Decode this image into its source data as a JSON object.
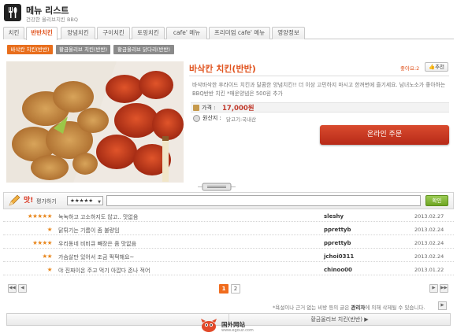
{
  "header": {
    "title": "메뉴 리스트",
    "subtitle": "건강한 올리브치킨 BBQ"
  },
  "tabs": [
    {
      "label": "치킨",
      "active": false
    },
    {
      "label": "반반치킨",
      "active": true
    },
    {
      "label": "양념치킨",
      "active": false
    },
    {
      "label": "구이치킨",
      "active": false
    },
    {
      "label": "토핑치킨",
      "active": false
    },
    {
      "label": "cafe' 메뉴",
      "active": false
    },
    {
      "label": "프리미엄 cafe' 메뉴",
      "active": false
    },
    {
      "label": "영양정보",
      "active": false
    }
  ],
  "subtabs": [
    {
      "label": "바삭칸 치킨(반반)",
      "active": true
    },
    {
      "label": "황금올리브 치킨(반반)",
      "active": false
    },
    {
      "label": "황금올리브 닭다리(반반)",
      "active": false
    }
  ],
  "product": {
    "name": "바삭칸 치킨(반반)",
    "like_label": "좋아요:2",
    "recommend_label": "추천",
    "description": "바삭바삭한 후라이드 치킨과 달콤한 양념치킨!! 더 이상 고민하지 마시고 한꺼번에 즐기세요. 남녀노소가 좋아하는 BBQ반반 치킨 *매운양념은 500원 추가",
    "price_label": "가격 :",
    "price_value": "17,000원",
    "origin_label": "원산지 :",
    "origin_value": "닭고기:국내산",
    "order_label": "온라인 주문"
  },
  "review_form": {
    "mat_label": "맛!",
    "label": "평가하기",
    "rating_value": "★★★★★",
    "confirm_label": "확인"
  },
  "reviews": [
    {
      "stars": "★★★★★",
      "text": "녹녹하고 고소하지도 않고.. 맛없음",
      "user": "sleshy",
      "date": "2013.02.27"
    },
    {
      "stars": "★",
      "text": "닭튀기는 기름이 좀 불량임",
      "user": "pprettyb",
      "date": "2013.02.24"
    },
    {
      "stars": "★★★★",
      "text": "우리동네 비비큐 빼장은 좀 맛없음",
      "user": "pprettyb",
      "date": "2013.02.24"
    },
    {
      "stars": "★★",
      "text": "가슴살만 있어서 조금 퍽퍽해요~",
      "user": "jchoi0311",
      "date": "2013.02.24"
    },
    {
      "stars": "★",
      "text": "야 진짜이온 주고 먹기 아깝다 존나 적어",
      "user": "chinoo00",
      "date": "2013.01.22"
    }
  ],
  "pagination": {
    "first_icon": "double-left-arrow-icon",
    "prev_icon": "left-arrow-icon",
    "next_icon": "right-arrow-icon",
    "last_icon": "double-right-arrow-icon",
    "pages": [
      "1",
      "2"
    ],
    "current": "1"
  },
  "notice": {
    "text_before": "*욕설이나 근거 없는 비방 등의 글은 ",
    "text_bold": "관리자",
    "text_after": "에 의해 삭제될 수 있습니다."
  },
  "bottom_nav": {
    "next_label": "황금올리브 치킨(반반) ▶"
  },
  "watermark": {
    "text": "国外网站",
    "url": "www.egouz.com"
  },
  "colors": {
    "accent": "#e0521d",
    "order_button": "#c93a22",
    "confirm_button": "#7cb42f",
    "star": "#e8861b"
  }
}
